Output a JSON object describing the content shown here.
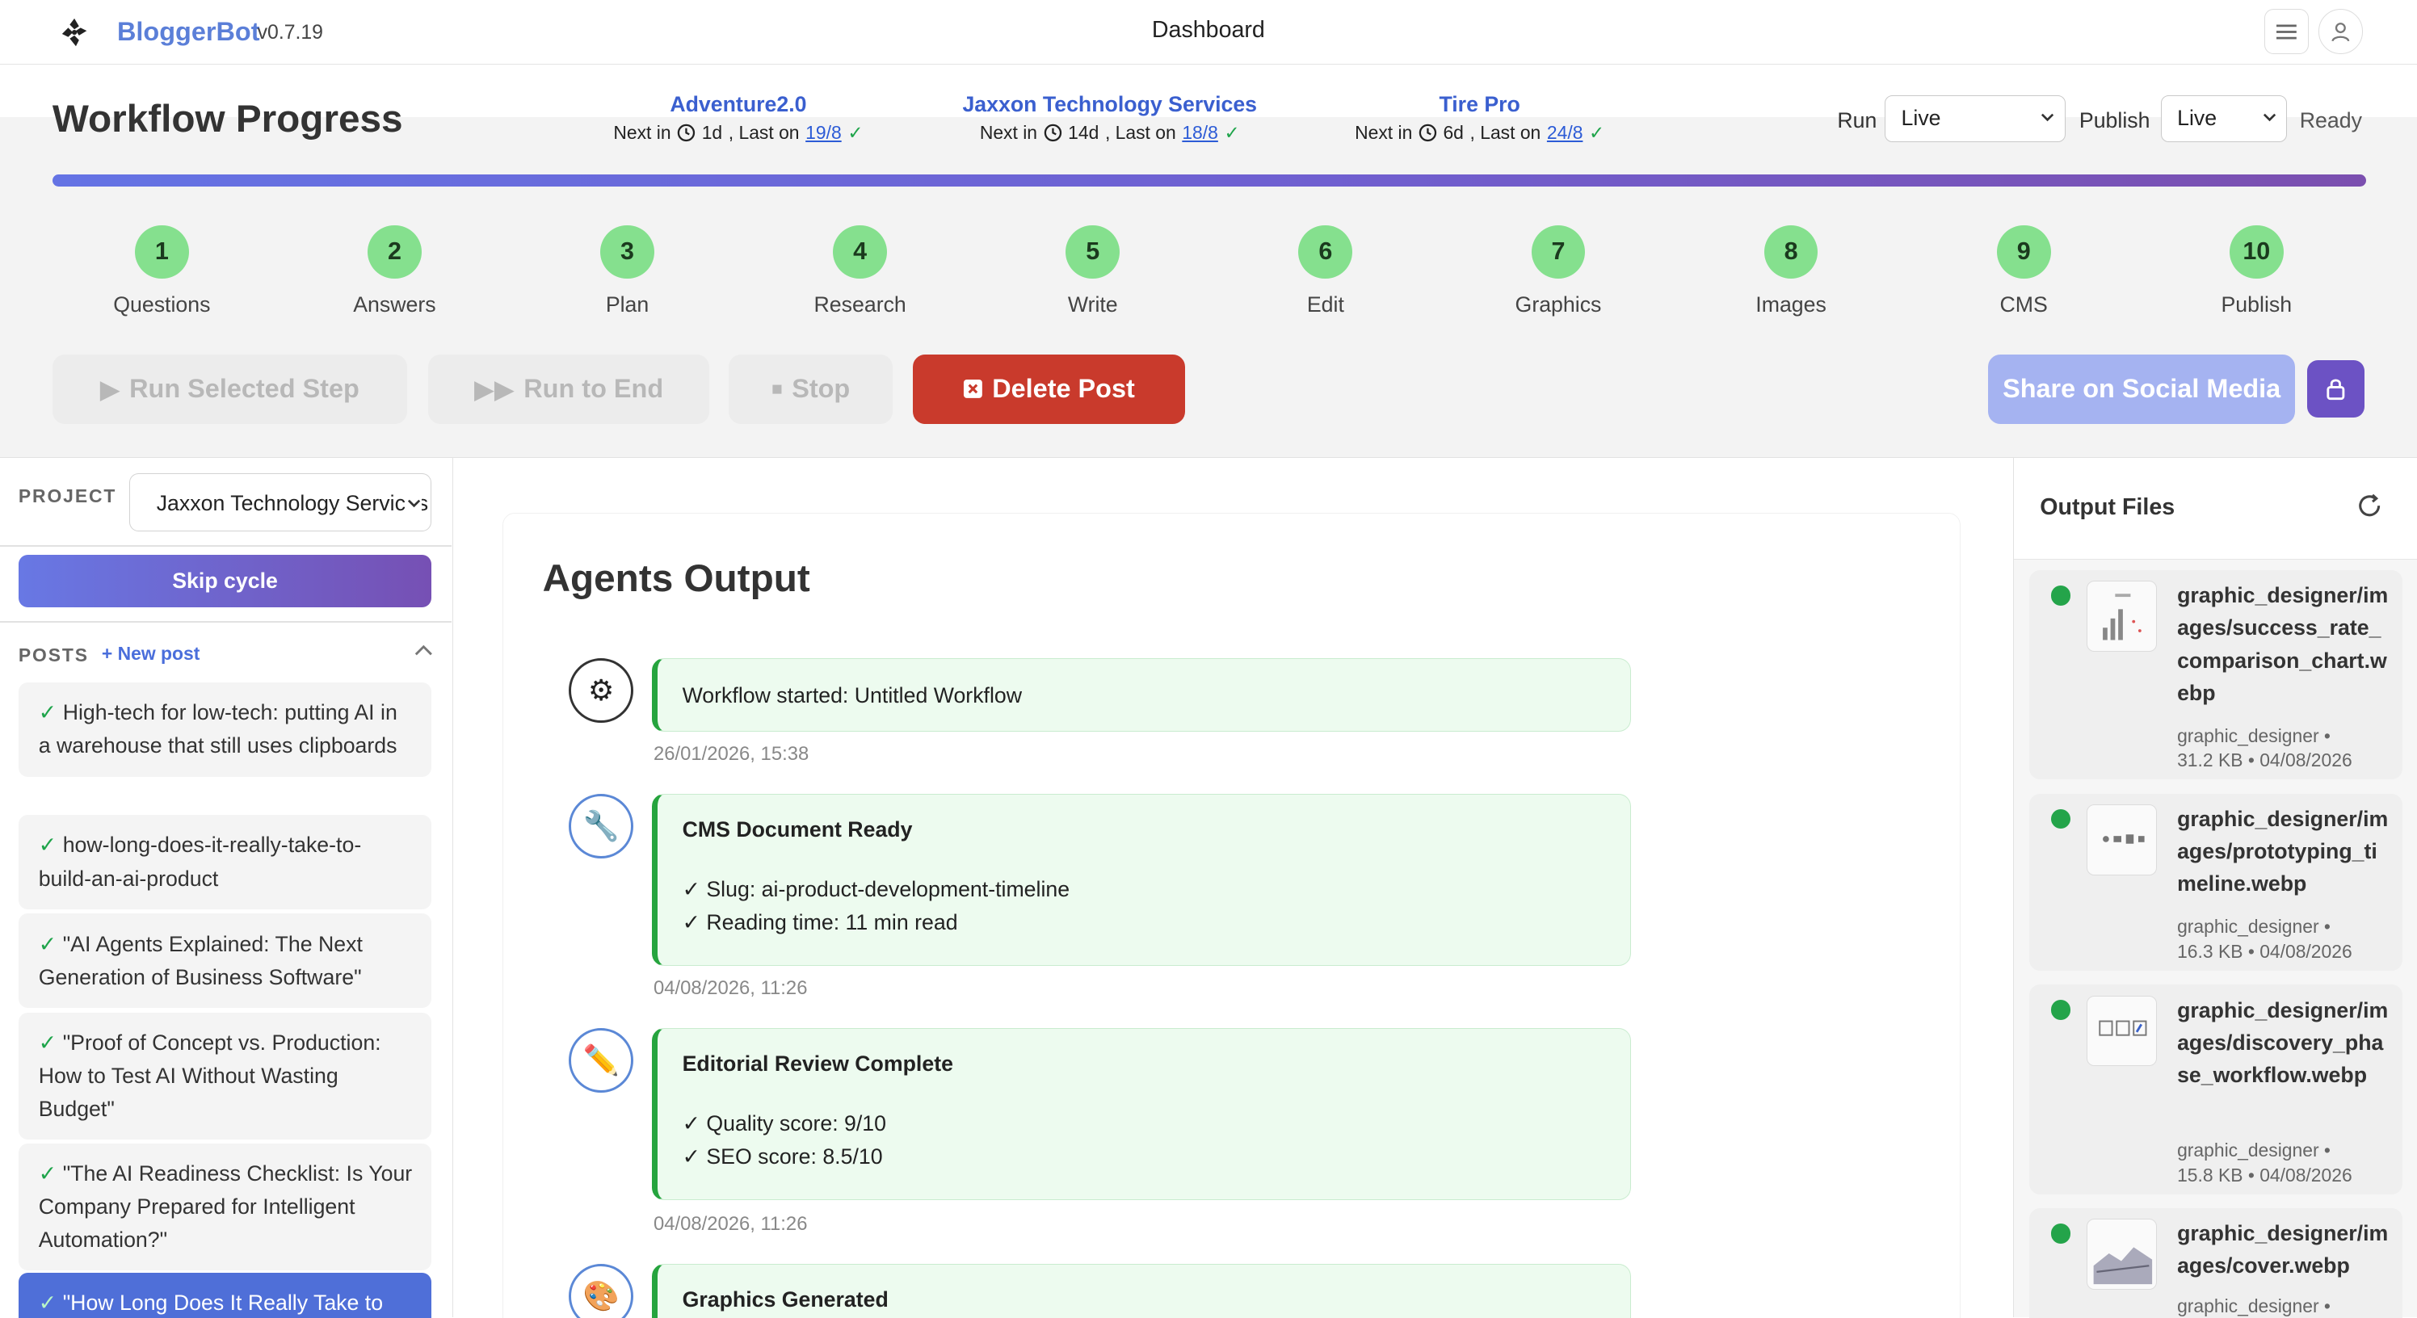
{
  "app": {
    "brand": "BloggerBot",
    "version": "v0.7.19",
    "page_title": "Dashboard"
  },
  "workflow": {
    "title": "Workflow Progress",
    "schedules": [
      {
        "name": "Adventure2.0",
        "next_prefix": "Next in",
        "next": "1d",
        "last_prefix": ", Last on",
        "last": "19/8"
      },
      {
        "name": "Jaxxon Technology Services",
        "next_prefix": "Next in",
        "next": "14d",
        "last_prefix": ", Last on",
        "last": "18/8"
      },
      {
        "name": "Tire Pro",
        "next_prefix": "Next in",
        "next": "6d",
        "last_prefix": ", Last on",
        "last": "24/8"
      }
    ],
    "run_label": "Run",
    "run_value": "Live",
    "publish_label": "Publish",
    "publish_value": "Live",
    "status": "Ready",
    "progress_fraction": 1.0,
    "steps": [
      {
        "num": "1",
        "label": "Questions"
      },
      {
        "num": "2",
        "label": "Answers"
      },
      {
        "num": "3",
        "label": "Plan"
      },
      {
        "num": "4",
        "label": "Research"
      },
      {
        "num": "5",
        "label": "Write"
      },
      {
        "num": "6",
        "label": "Edit"
      },
      {
        "num": "7",
        "label": "Graphics"
      },
      {
        "num": "8",
        "label": "Images"
      },
      {
        "num": "9",
        "label": "CMS"
      },
      {
        "num": "10",
        "label": "Publish"
      }
    ],
    "buttons": {
      "run_selected": "Run Selected Step",
      "run_to_end": "Run to End",
      "stop": "Stop",
      "delete": "Delete Post",
      "share": "Share on Social Media"
    }
  },
  "sidebar": {
    "project_label": "PROJECT",
    "project_value": "Jaxxon Technology Services",
    "skip_label": "Skip cycle",
    "posts_label": "POSTS",
    "new_post_label": "+ New post",
    "posts": [
      {
        "title": "High-tech for low-tech: putting AI in a warehouse that still uses clipboards",
        "done": true
      },
      {
        "title": "how-long-does-it-really-take-to-build-an-ai-product",
        "done": true
      },
      {
        "title": "\"AI Agents Explained: The Next Generation of Business Software\"",
        "done": true
      },
      {
        "title": "\"Proof of Concept vs. Production: How to Test AI Without Wasting Budget\"",
        "done": true
      },
      {
        "title": "\"The AI Readiness Checklist: Is Your Company Prepared for Intelligent Automation?\"",
        "done": true
      },
      {
        "title": "\"How Long Does It Really Take to",
        "done": true,
        "selected": true
      }
    ]
  },
  "agents": {
    "title": "Agents Output",
    "events": [
      {
        "icon": "gear-icon",
        "title": "",
        "lines": [
          "Workflow started: Untitled Workflow"
        ],
        "time": "26/01/2026, 15:38"
      },
      {
        "icon": "wrench-icon",
        "title": "CMS Document Ready",
        "lines": [
          "✓ Slug: ai-product-development-timeline",
          "✓ Reading time: 11 min read"
        ],
        "time": "04/08/2026, 11:26"
      },
      {
        "icon": "pencil-icon",
        "title": "Editorial Review Complete",
        "lines": [
          "✓ Quality score: 9/10",
          "✓ SEO score: 8.5/10"
        ],
        "time": "04/08/2026, 11:26"
      },
      {
        "icon": "palette-icon",
        "title": "Graphics Generated",
        "lines": [],
        "time": ""
      }
    ]
  },
  "output_files": {
    "title": "Output Files",
    "files": [
      {
        "name": "graphic_designer/images/success_rate_comparison_chart.webp",
        "agent": "graphic_designer •",
        "meta": "31.2 KB • 04/08/2026",
        "status_color": "#24a44a"
      },
      {
        "name": "graphic_designer/images/prototyping_timeline.webp",
        "agent": "graphic_designer •",
        "meta": "16.3 KB • 04/08/2026",
        "status_color": "#24a44a"
      },
      {
        "name": "graphic_designer/images/discovery_phase_workflow.webp",
        "agent": "graphic_designer •",
        "meta": "15.8 KB • 04/08/2026",
        "status_color": "#24a44a"
      },
      {
        "name": "graphic_designer/images/cover.webp",
        "agent": "graphic_designer •",
        "meta": "",
        "status_color": "#24a44a"
      }
    ]
  },
  "colors": {
    "brand": "#5b7fd8",
    "step_done": "#85e08e",
    "delete": "#c93a2c",
    "success": "#24a44a",
    "accent_purple": "#6c52c4"
  }
}
